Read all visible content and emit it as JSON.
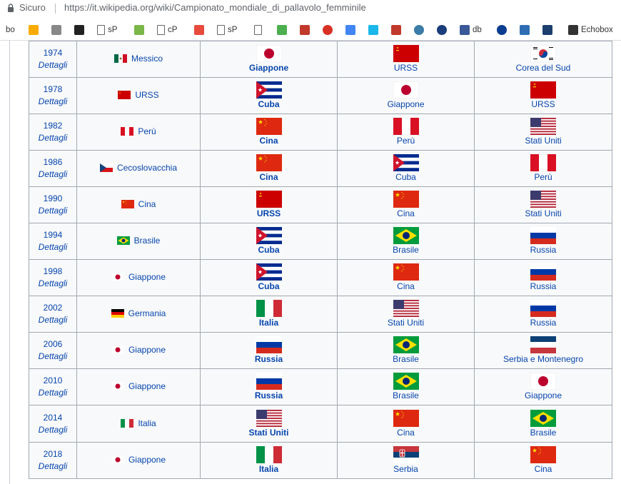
{
  "browser": {
    "secure_label": "Sicuro",
    "url_host": "https://it.wikipedia.org",
    "url_path": "/wiki/Campionato_mondiale_di_pallavolo_femminile",
    "bookmarks": [
      {
        "label": "bo",
        "icon": "text"
      },
      {
        "label": "",
        "icon": "analytics-icon"
      },
      {
        "label": "",
        "icon": "mmc-icon"
      },
      {
        "label": "",
        "icon": "bow-icon"
      },
      {
        "label": "sP",
        "icon": "page-icon"
      },
      {
        "label": "",
        "icon": "cu-icon"
      },
      {
        "label": "cP",
        "icon": "page-icon"
      },
      {
        "label": "",
        "icon": "puzzle-icon"
      },
      {
        "label": "sP",
        "icon": "page-icon"
      },
      {
        "label": "",
        "icon": "page-icon"
      },
      {
        "label": "",
        "icon": "image-icon"
      },
      {
        "label": "",
        "icon": "dna-icon"
      },
      {
        "label": "",
        "icon": "red-circle-icon"
      },
      {
        "label": "",
        "icon": "translate-icon"
      },
      {
        "label": "",
        "icon": "vimeo-icon"
      },
      {
        "label": "",
        "icon": "wm-icon"
      },
      {
        "label": "",
        "icon": "globe-icon"
      },
      {
        "label": "",
        "icon": "grid-circle-icon"
      },
      {
        "label": "db",
        "icon": "facebook-icon"
      },
      {
        "label": "",
        "icon": "nasa-icon"
      },
      {
        "label": "",
        "icon": "doc-icon"
      },
      {
        "label": "",
        "icon": "arrow-icon"
      },
      {
        "label": "Echobox",
        "icon": "echobox-icon"
      }
    ]
  },
  "table": {
    "details_label": "Dettagli",
    "rows": [
      {
        "year": "1974",
        "host": "Messico",
        "host_flag": "mexico",
        "gold": "Giappone",
        "gold_flag": "japan",
        "silver": "URSS",
        "silver_flag": "ussr",
        "bronze": "Corea del Sud",
        "bronze_flag": "korea"
      },
      {
        "year": "1978",
        "host": "URSS",
        "host_flag": "ussr",
        "gold": "Cuba",
        "gold_flag": "cuba",
        "silver": "Giappone",
        "silver_flag": "japan",
        "bronze": "URSS",
        "bronze_flag": "ussr"
      },
      {
        "year": "1982",
        "host": "Perù",
        "host_flag": "peru",
        "gold": "Cina",
        "gold_flag": "china",
        "silver": "Perù",
        "silver_flag": "peru",
        "bronze": "Stati Uniti",
        "bronze_flag": "usa"
      },
      {
        "year": "1986",
        "host": "Cecoslovacchia",
        "host_flag": "czech",
        "gold": "Cina",
        "gold_flag": "china",
        "silver": "Cuba",
        "silver_flag": "cuba",
        "bronze": "Perù",
        "bronze_flag": "peru"
      },
      {
        "year": "1990",
        "host": "Cina",
        "host_flag": "china",
        "gold": "URSS",
        "gold_flag": "ussr",
        "silver": "Cina",
        "silver_flag": "china",
        "bronze": "Stati Uniti",
        "bronze_flag": "usa"
      },
      {
        "year": "1994",
        "host": "Brasile",
        "host_flag": "brazil",
        "gold": "Cuba",
        "gold_flag": "cuba",
        "silver": "Brasile",
        "silver_flag": "brazil",
        "bronze": "Russia",
        "bronze_flag": "russia"
      },
      {
        "year": "1998",
        "host": "Giappone",
        "host_flag": "japan",
        "gold": "Cuba",
        "gold_flag": "cuba",
        "silver": "Cina",
        "silver_flag": "china",
        "bronze": "Russia",
        "bronze_flag": "russia"
      },
      {
        "year": "2002",
        "host": "Germania",
        "host_flag": "germany",
        "gold": "Italia",
        "gold_flag": "italy",
        "silver": "Stati Uniti",
        "silver_flag": "usa",
        "bronze": "Russia",
        "bronze_flag": "russia"
      },
      {
        "year": "2006",
        "host": "Giappone",
        "host_flag": "japan",
        "gold": "Russia",
        "gold_flag": "russia",
        "silver": "Brasile",
        "silver_flag": "brazil",
        "bronze": "Serbia e Montenegro",
        "bronze_flag": "scg"
      },
      {
        "year": "2010",
        "host": "Giappone",
        "host_flag": "japan",
        "gold": "Russia",
        "gold_flag": "russia",
        "silver": "Brasile",
        "silver_flag": "brazil",
        "bronze": "Giappone",
        "bronze_flag": "japan"
      },
      {
        "year": "2014",
        "host": "Italia",
        "host_flag": "italy",
        "gold": "Stati Uniti",
        "gold_flag": "usa",
        "silver": "Cina",
        "silver_flag": "china",
        "bronze": "Brasile",
        "bronze_flag": "brazil"
      },
      {
        "year": "2018",
        "host": "Giappone",
        "host_flag": "japan",
        "gold": "Italia",
        "gold_flag": "italy",
        "silver": "Serbia",
        "silver_flag": "serbia",
        "bronze": "Cina",
        "bronze_flag": "china"
      }
    ]
  },
  "colors": {
    "link": "#0645ad",
    "table_bg": "#f8f9fa",
    "table_border": "#a2a9b1"
  }
}
